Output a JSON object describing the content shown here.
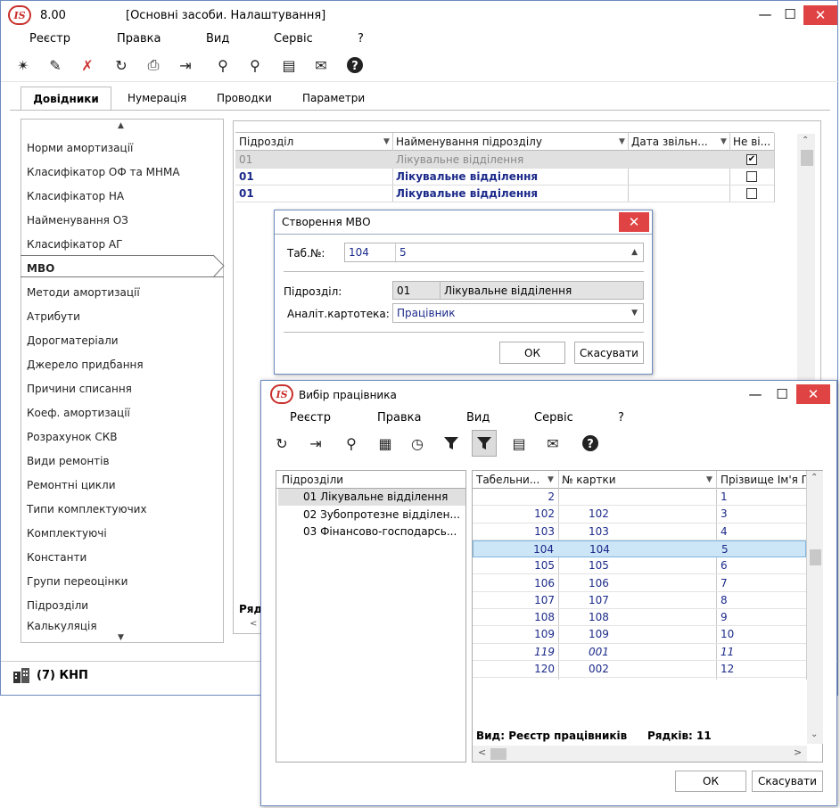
{
  "main": {
    "version": "8.00",
    "title": "[Основні засоби. Налаштування]",
    "menu": [
      "Реєстр",
      "Правка",
      "Вид",
      "Сервіс",
      "?"
    ],
    "tabs": [
      "Довідники",
      "Нумерація",
      "Проводки",
      "Параметри"
    ],
    "sidebar": [
      "Норми амортизації",
      "Класифікатор ОФ та МНМА",
      "Класифікатор НА",
      "Найменування ОЗ",
      "Класифікатор АГ",
      "МВО",
      "Методи амортизації",
      "Атрибути",
      "Дорогматеріали",
      "Джерело придбання",
      "Причини списання",
      "Коеф. амортизації",
      "Розрахунок СКВ",
      "Види ремонтів",
      "Ремонтні цикли",
      "Типи комплектуючих",
      "Комплектуючі",
      "Константи",
      "Групи переоцінки",
      "Підрозділи",
      "Калькуляція"
    ],
    "grid": {
      "columns": [
        "Підрозділ",
        "Найменування підрозділу",
        "Дата звільн...",
        "Не ві..."
      ],
      "rows": [
        {
          "code": "01",
          "name": "Лікувальне відділення",
          "checked": "✔"
        },
        {
          "code": "01",
          "name": "Лікувальне відділення",
          "checked": ""
        },
        {
          "code": "01",
          "name": "Лікувальне відділення",
          "checked": ""
        }
      ],
      "footer_partial": "Ряд"
    },
    "status": "(7) КНП"
  },
  "dialog_mvo": {
    "title": "Створення МВО",
    "tab_label": "Таб.№:",
    "tab_code": "104",
    "tab_value": "5",
    "dept_label": "Підрозділ:",
    "dept_code": "01",
    "dept_name": "Лікувальне відділення",
    "card_label": "Аналіт.картотека:",
    "card_value": "Працівник",
    "ok": "ОК",
    "cancel": "Скасувати"
  },
  "dialog_emp": {
    "title": "Вибір працівника",
    "menu": [
      "Реєстр",
      "Правка",
      "Вид",
      "Сервіс",
      "?"
    ],
    "tree_header": "Підрозділи",
    "tree": [
      "01 Лікувальне відділення",
      "02 Зубопротезне відділен...",
      "03 Фінансово-господарсь..."
    ],
    "columns": [
      "Табельни...",
      "№ картки",
      "Прізвище Ім'я П"
    ],
    "rows": [
      {
        "tab": "2",
        "card": "",
        "name": "1",
        "italic": false
      },
      {
        "tab": "102",
        "card": "102",
        "name": "3",
        "italic": false
      },
      {
        "tab": "103",
        "card": "103",
        "name": "4",
        "italic": false
      },
      {
        "tab": "104",
        "card": "104",
        "name": "5",
        "italic": false
      },
      {
        "tab": "105",
        "card": "105",
        "name": "6",
        "italic": false
      },
      {
        "tab": "106",
        "card": "106",
        "name": "7",
        "italic": false
      },
      {
        "tab": "107",
        "card": "107",
        "name": "8",
        "italic": false
      },
      {
        "tab": "108",
        "card": "108",
        "name": "9",
        "italic": false
      },
      {
        "tab": "109",
        "card": "109",
        "name": "10",
        "italic": false
      },
      {
        "tab": "119",
        "card": "001",
        "name": "11",
        "italic": true
      },
      {
        "tab": "120",
        "card": "002",
        "name": "12",
        "italic": false
      }
    ],
    "footer_view": "Вид: Реєстр працівників",
    "footer_rows": "Рядків: 11",
    "ok": "ОК",
    "cancel": "Скасувати"
  }
}
